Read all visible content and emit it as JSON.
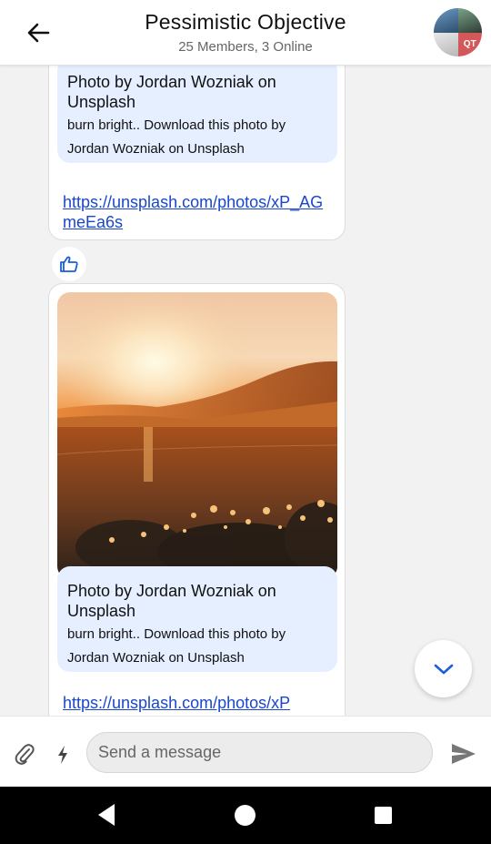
{
  "header": {
    "title": "Pessimistic Objective",
    "subtitle": "25 Members, 3 Online",
    "avatar_badge": "QT"
  },
  "messages": [
    {
      "card_title": "Photo by Jordan Wozniak on Unsplash",
      "card_description": "burn bright.. Download this photo by Jordan Wozniak on Unsplash",
      "link": "https://unsplash.com/photos/xP_AGmeEa6s",
      "reaction": "thumbs-up"
    },
    {
      "card_title": "Photo by Jordan Wozniak on Unsplash",
      "card_description": "burn bright.. Download this photo by Jordan Wozniak on Unsplash",
      "link": "https://unsplash.com/photos/xP"
    }
  ],
  "composer": {
    "placeholder": "Send a message"
  },
  "colors": {
    "link": "#1a47c9",
    "card_bg": "#e6efff",
    "accent": "#1a5fd6"
  },
  "icons": {
    "back": "arrow-left-icon",
    "attach": "paperclip-icon",
    "bolt": "lightning-icon",
    "send": "send-icon",
    "scroll_down": "chevron-down-icon",
    "like": "thumbs-up-icon"
  }
}
